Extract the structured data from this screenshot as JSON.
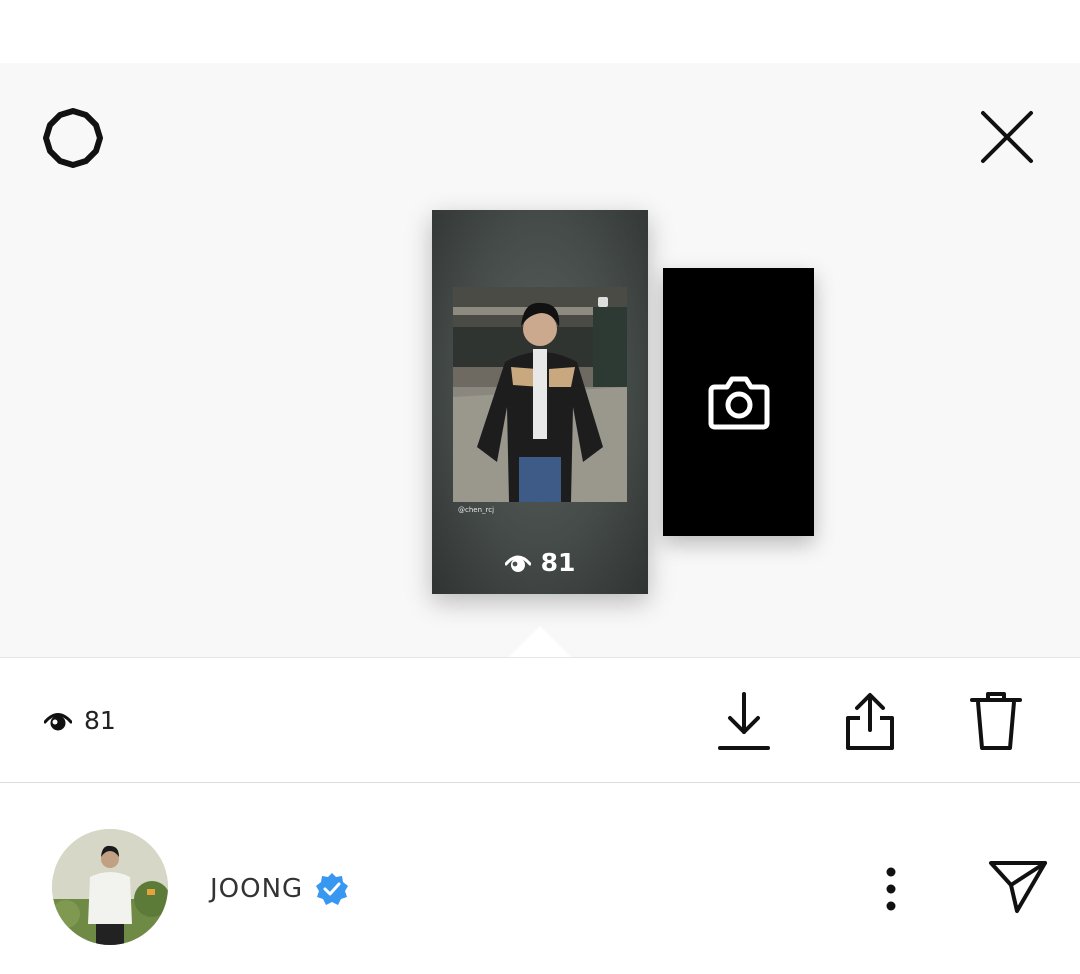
{
  "story": {
    "credit": "@chen_rcj",
    "view_count": "81"
  },
  "action_bar": {
    "view_count": "81"
  },
  "profile": {
    "username": "JOONG",
    "verified": true
  },
  "icons": {
    "settings": "settings-gear-icon",
    "close": "close-icon",
    "camera": "camera-icon",
    "eye": "eye-icon",
    "download": "download-icon",
    "share": "share-icon",
    "delete": "trash-icon",
    "verified": "verified-badge-icon",
    "more": "more-vertical-icon",
    "send": "send-icon"
  },
  "colors": {
    "verified_badge": "#3897f0",
    "background": "#f8f8f8"
  }
}
